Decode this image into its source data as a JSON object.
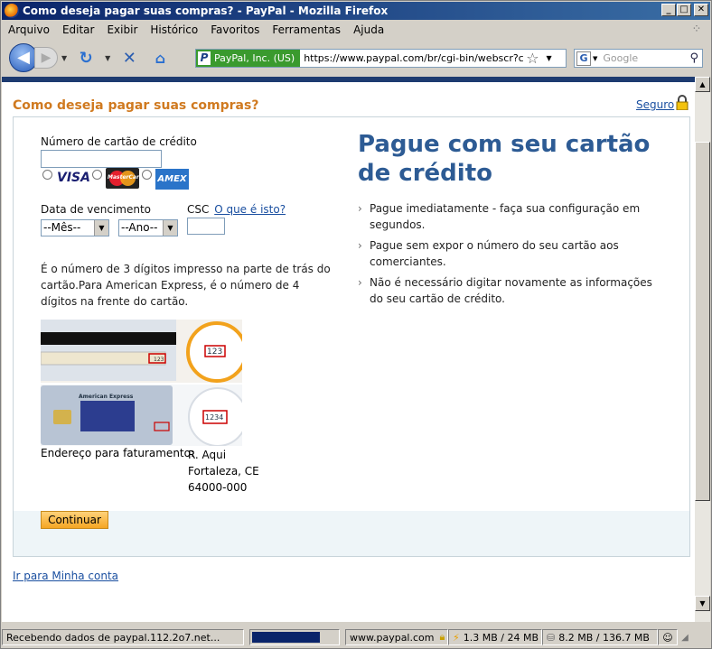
{
  "window": {
    "title": "Como deseja pagar suas compras? - PayPal - Mozilla Firefox"
  },
  "menu": [
    "Arquivo",
    "Editar",
    "Exibir",
    "Histórico",
    "Favoritos",
    "Ferramentas",
    "Ajuda"
  ],
  "nav": {
    "identity": "PayPal, Inc. (US)",
    "url": "https://www.paypal.com/br/cgi-bin/webscr?cmd=_",
    "search_placeholder": "Google"
  },
  "page": {
    "title": "Como deseja pagar suas compras?",
    "secure_link": "Seguro",
    "card_number_label": "Número de cartão de crédito",
    "card_number_value": "",
    "brands": [
      "VISA",
      "MasterCard",
      "AMEX"
    ],
    "expiry_label": "Data de vencimento",
    "month_select": "--Mês--",
    "year_select": "--Ano--",
    "csc_label": "CSC",
    "csc_help_link": "O que é isto?",
    "csc_info": "É o número de 3 dígitos impresso na parte de trás do cartão.Para American Express, é o número de 4 dígitos na frente do cartão.",
    "card_image_texts": {
      "amex_brand": "American Express",
      "csc3": "123",
      "csc4": "1234"
    },
    "address_label": "Endereço para faturamento:",
    "address_lines": [
      "R. Aqui",
      "Fortaleza, CE",
      "64000-000"
    ],
    "continue_button": "Continuar",
    "heading": "Pague com seu cartão de crédito",
    "benefits": [
      "Pague imediatamente - faça sua configuração em segundos.",
      "Pague sem expor o número do seu cartão aos comerciantes.",
      "Não é necessário digitar novamente as informações do seu cartão de crédito."
    ],
    "account_link": "Ir para Minha conta"
  },
  "statusbar": {
    "message": "Recebendo dados de paypal.112.2o7.net...",
    "progress": 0.8,
    "domain": "www.paypal.com",
    "memory1": "1.3 MB / 24 MB",
    "memory2": "8.2 MB / 136.7 MB"
  }
}
